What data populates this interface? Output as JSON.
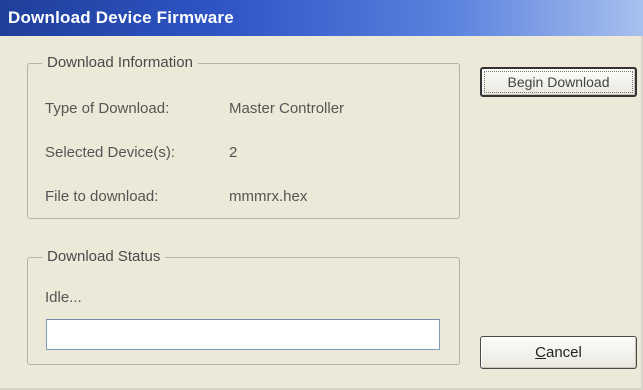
{
  "window": {
    "title": "Download Device Firmware"
  },
  "info_group": {
    "legend": "Download Information",
    "rows": [
      {
        "label": "Type of Download:",
        "value": "Master Controller"
      },
      {
        "label": "Selected Device(s):",
        "value": "2"
      },
      {
        "label": "File to download:",
        "value": "mmmrx.hex"
      }
    ]
  },
  "status_group": {
    "legend": "Download Status",
    "status_text": "Idle...",
    "progress_fraction": 0
  },
  "buttons": {
    "begin_label": "Begin Download",
    "cancel_mnemonic": "C",
    "cancel_rest": "ancel"
  },
  "colors": {
    "title_bar": "#2f55c6",
    "dialog_bg": "#ece9d8",
    "progress_fill": "#3c9c3c"
  }
}
